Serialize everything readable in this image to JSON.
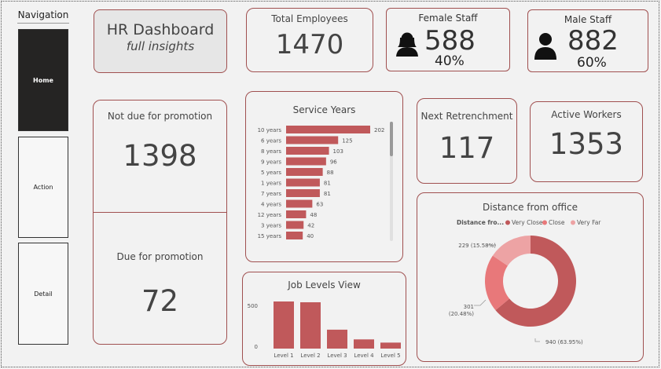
{
  "nav": {
    "title": "Navigation",
    "items": [
      {
        "label": "Home",
        "active": true
      },
      {
        "label": "Action",
        "active": false
      },
      {
        "label": "Detail",
        "active": false
      }
    ]
  },
  "header": {
    "title": "HR Dashboard",
    "subtitle": "full insights"
  },
  "kpis": {
    "total_employees": {
      "label": "Total Employees",
      "value": "1470"
    },
    "female": {
      "label": "Female Staff",
      "value": "588",
      "pct": "40%"
    },
    "male": {
      "label": "Male Staff",
      "value": "882",
      "pct": "60%"
    },
    "not_due": {
      "label": "Not due for promotion",
      "value": "1398"
    },
    "due": {
      "label": "Due for promotion",
      "value": "72"
    },
    "retrenchment": {
      "label": "Next Retrenchment",
      "value": "117"
    },
    "active": {
      "label": "Active Workers",
      "value": "1353"
    }
  },
  "colors": {
    "accent": "#c0595b",
    "border": "#a05050",
    "active_nav": "#252423"
  },
  "chart_data": [
    {
      "type": "bar",
      "orientation": "horizontal",
      "title": "Service Years",
      "categories": [
        "10 years",
        "6 years",
        "8 years",
        "9 years",
        "5 years",
        "1 years",
        "7 years",
        "4 years",
        "12 years",
        "3 years",
        "15 years"
      ],
      "values": [
        202,
        125,
        103,
        96,
        88,
        81,
        81,
        63,
        48,
        42,
        40
      ],
      "color": "#c0595b"
    },
    {
      "type": "bar",
      "title": "Job Levels View",
      "categories": [
        "Level 1",
        "Level 2",
        "Level 3",
        "Level 4",
        "Level 5"
      ],
      "values": [
        543,
        534,
        218,
        106,
        69
      ],
      "ylim": [
        0,
        543
      ],
      "yticks": [
        "500",
        "0"
      ],
      "color": "#c0595b"
    },
    {
      "type": "pie",
      "title": "Distance from office",
      "legend_title": "Distance fro...",
      "legend_position": "top",
      "slices": [
        {
          "name": "Very Close",
          "value": 940,
          "label": "940 (63.95%)",
          "color": "#c0595b"
        },
        {
          "name": "Close",
          "value": 301,
          "label_value": "301",
          "label_pct": "(20.48%)",
          "color": "#e8787a"
        },
        {
          "name": "Very Far",
          "value": 229,
          "label": "229 (15.58%)",
          "color": "#eda3a4"
        }
      ]
    }
  ]
}
